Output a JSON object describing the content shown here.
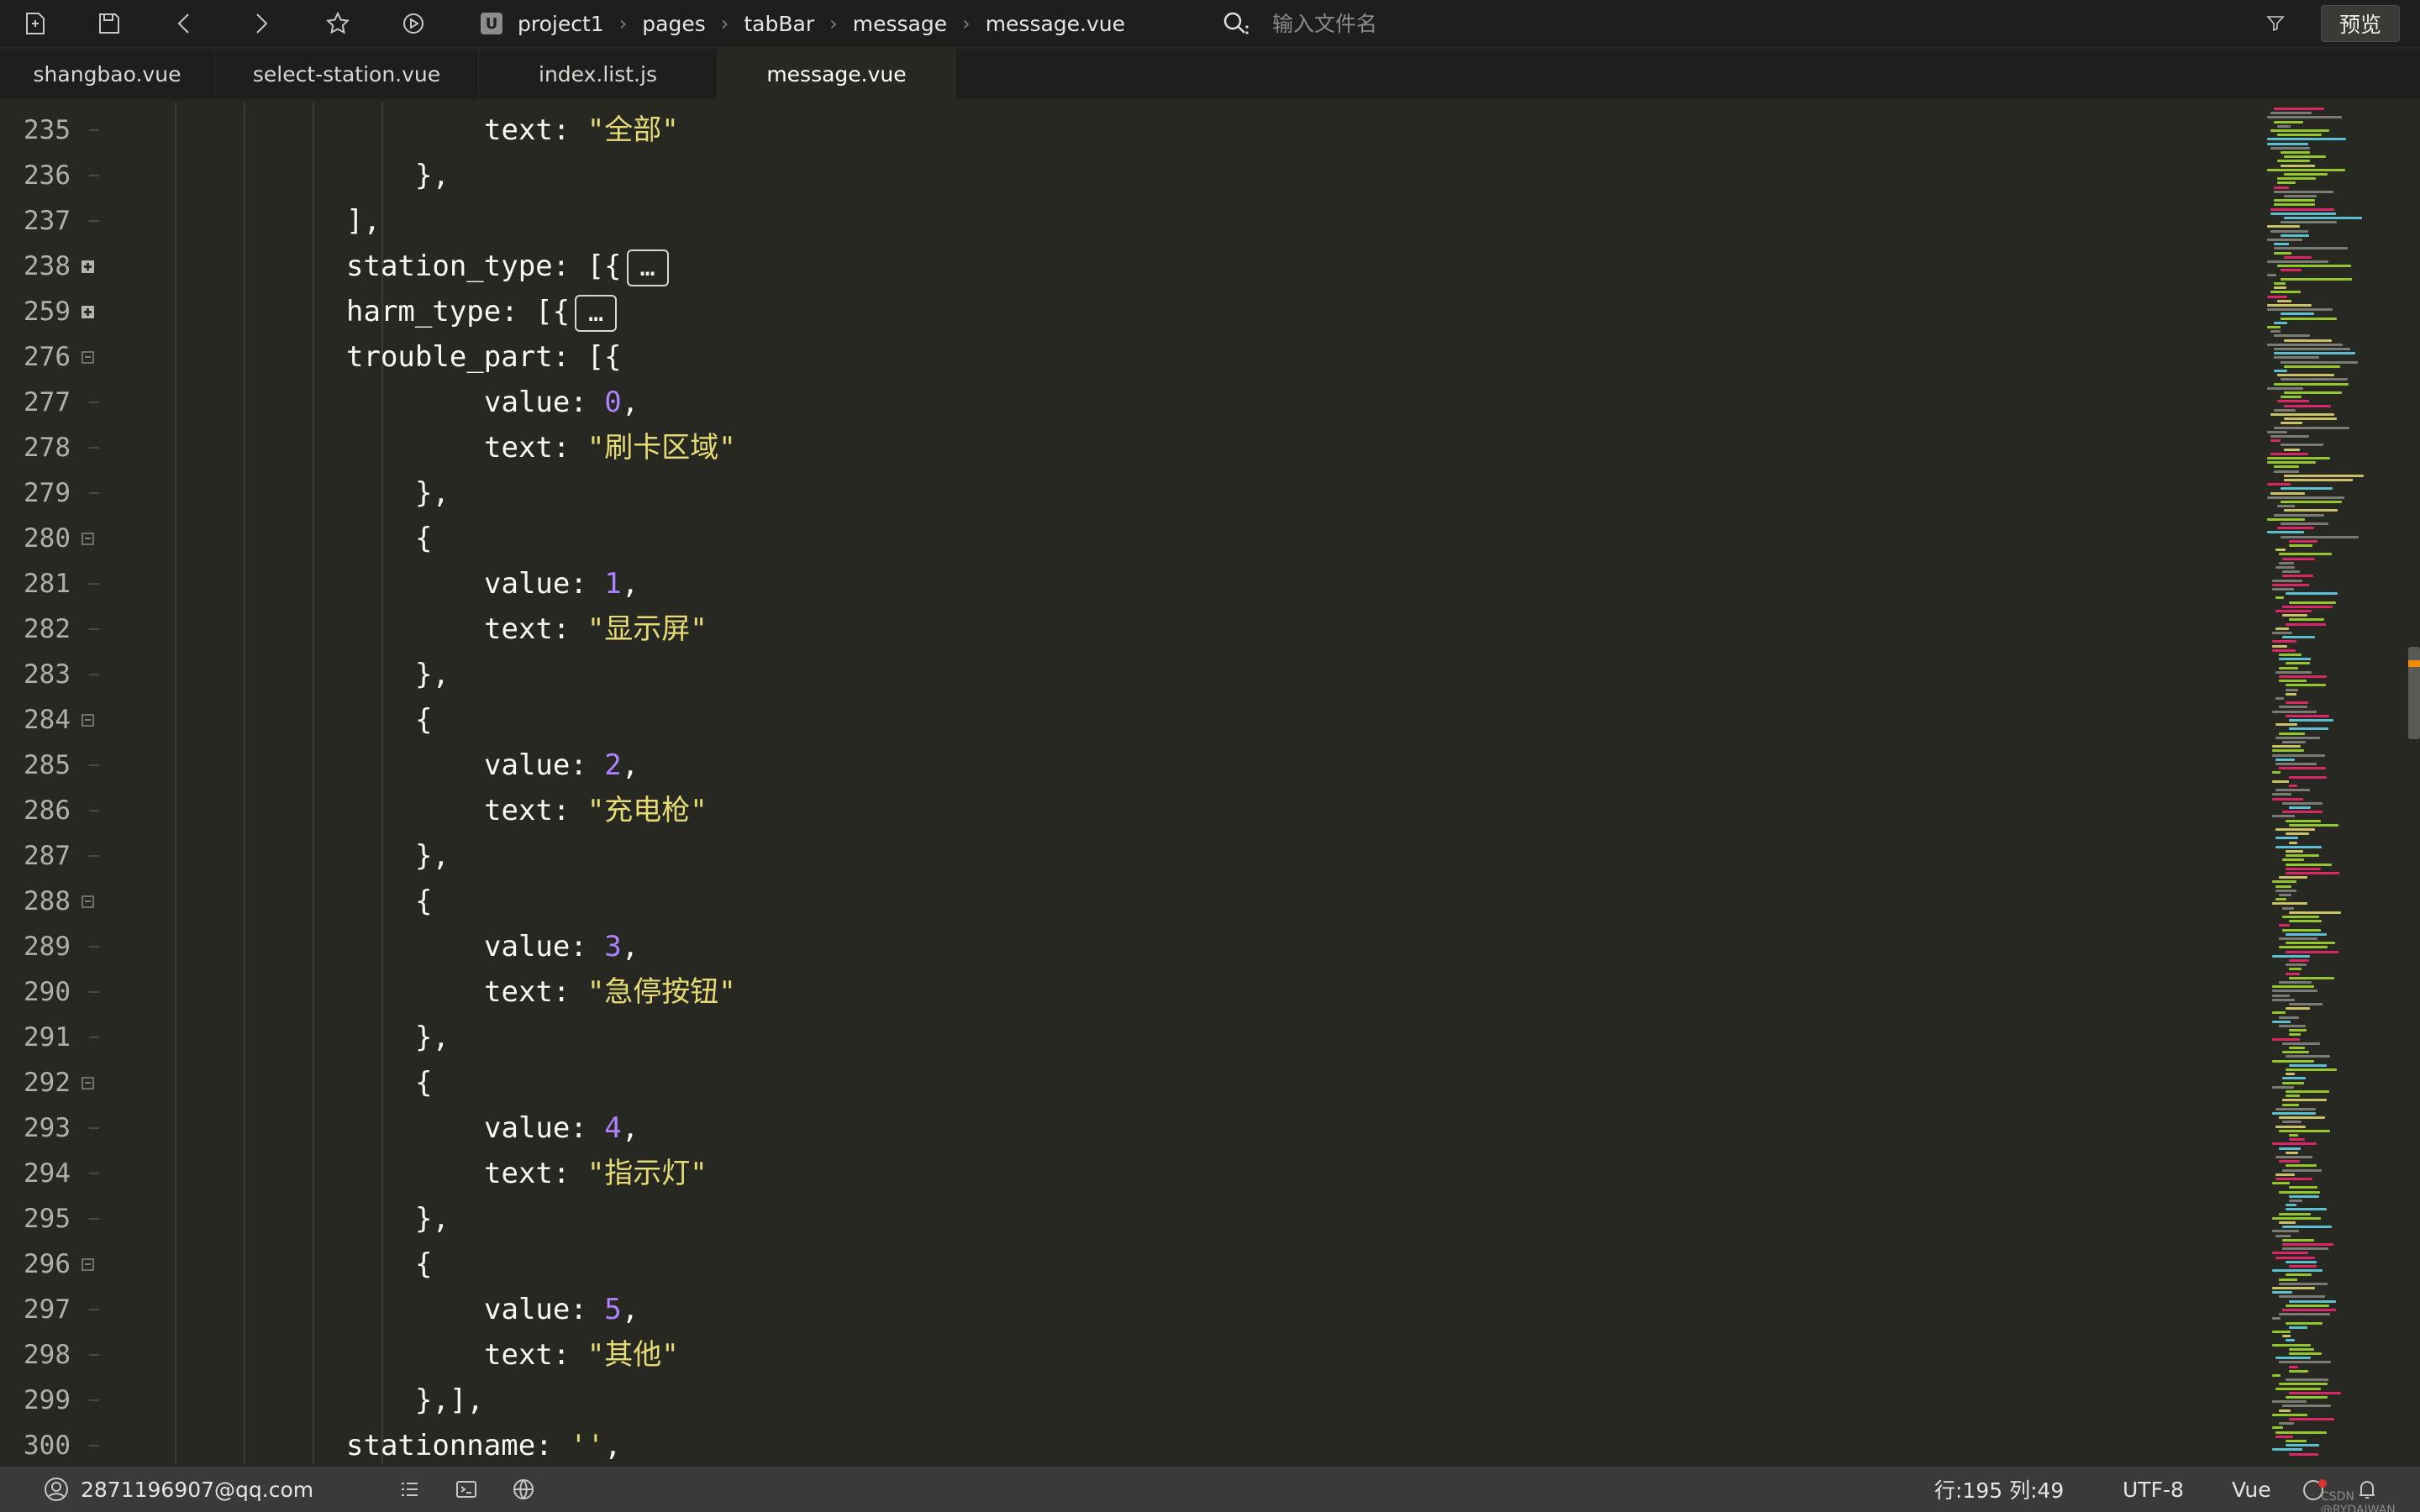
{
  "toolbar": {
    "icons": [
      "new-file-icon",
      "save-icon",
      "back-icon",
      "forward-icon",
      "star-icon",
      "run-icon"
    ],
    "breadcrumb": [
      "project1",
      "pages",
      "tabBar",
      "message",
      "message.vue"
    ],
    "search_placeholder": "输入文件名",
    "preview_label": "预览"
  },
  "tabs": [
    {
      "label": "shangbao.vue",
      "active": false
    },
    {
      "label": "select-station.vue",
      "active": false
    },
    {
      "label": "index.list.js",
      "active": false
    },
    {
      "label": "message.vue",
      "active": true
    }
  ],
  "editor": {
    "lines": [
      {
        "n": "235",
        "fold": "",
        "indent": 6,
        "tokens": [
          [
            "p",
            "text: "
          ],
          [
            "s",
            "\"全部\""
          ]
        ]
      },
      {
        "n": "236",
        "fold": "",
        "indent": 5,
        "tokens": [
          [
            "p",
            "},"
          ]
        ]
      },
      {
        "n": "237",
        "fold": "",
        "indent": 4,
        "tokens": [
          [
            "p",
            "],"
          ]
        ]
      },
      {
        "n": "238",
        "fold": "plus",
        "indent": 4,
        "tokens": [
          [
            "p",
            "station_type: [{"
          ],
          [
            "b",
            "…"
          ]
        ]
      },
      {
        "n": "259",
        "fold": "plus",
        "indent": 4,
        "tokens": [
          [
            "p",
            "harm_type: [{"
          ],
          [
            "b",
            "…"
          ]
        ]
      },
      {
        "n": "276",
        "fold": "minus",
        "indent": 4,
        "tokens": [
          [
            "p",
            "trouble_part: [{"
          ]
        ]
      },
      {
        "n": "277",
        "fold": "",
        "indent": 6,
        "tokens": [
          [
            "p",
            "value: "
          ],
          [
            "n",
            "0"
          ],
          [
            "p",
            ","
          ]
        ]
      },
      {
        "n": "278",
        "fold": "",
        "indent": 6,
        "tokens": [
          [
            "p",
            "text: "
          ],
          [
            "s",
            "\"刷卡区域\""
          ]
        ]
      },
      {
        "n": "279",
        "fold": "",
        "indent": 5,
        "tokens": [
          [
            "p",
            "},"
          ]
        ]
      },
      {
        "n": "280",
        "fold": "minus",
        "indent": 5,
        "tokens": [
          [
            "p",
            "{"
          ]
        ]
      },
      {
        "n": "281",
        "fold": "",
        "indent": 6,
        "tokens": [
          [
            "p",
            "value: "
          ],
          [
            "n",
            "1"
          ],
          [
            "p",
            ","
          ]
        ]
      },
      {
        "n": "282",
        "fold": "",
        "indent": 6,
        "tokens": [
          [
            "p",
            "text: "
          ],
          [
            "s",
            "\"显示屏\""
          ]
        ]
      },
      {
        "n": "283",
        "fold": "",
        "indent": 5,
        "tokens": [
          [
            "p",
            "},"
          ]
        ]
      },
      {
        "n": "284",
        "fold": "minus",
        "indent": 5,
        "tokens": [
          [
            "p",
            "{"
          ]
        ]
      },
      {
        "n": "285",
        "fold": "",
        "indent": 6,
        "tokens": [
          [
            "p",
            "value: "
          ],
          [
            "n",
            "2"
          ],
          [
            "p",
            ","
          ]
        ]
      },
      {
        "n": "286",
        "fold": "",
        "indent": 6,
        "tokens": [
          [
            "p",
            "text: "
          ],
          [
            "s",
            "\"充电枪\""
          ]
        ]
      },
      {
        "n": "287",
        "fold": "",
        "indent": 5,
        "tokens": [
          [
            "p",
            "},"
          ]
        ]
      },
      {
        "n": "288",
        "fold": "minus",
        "indent": 5,
        "tokens": [
          [
            "p",
            "{"
          ]
        ]
      },
      {
        "n": "289",
        "fold": "",
        "indent": 6,
        "tokens": [
          [
            "p",
            "value: "
          ],
          [
            "n",
            "3"
          ],
          [
            "p",
            ","
          ]
        ]
      },
      {
        "n": "290",
        "fold": "",
        "indent": 6,
        "tokens": [
          [
            "p",
            "text: "
          ],
          [
            "s",
            "\"急停按钮\""
          ]
        ]
      },
      {
        "n": "291",
        "fold": "",
        "indent": 5,
        "tokens": [
          [
            "p",
            "},"
          ]
        ]
      },
      {
        "n": "292",
        "fold": "minus",
        "indent": 5,
        "tokens": [
          [
            "p",
            "{"
          ]
        ]
      },
      {
        "n": "293",
        "fold": "",
        "indent": 6,
        "tokens": [
          [
            "p",
            "value: "
          ],
          [
            "n",
            "4"
          ],
          [
            "p",
            ","
          ]
        ]
      },
      {
        "n": "294",
        "fold": "",
        "indent": 6,
        "tokens": [
          [
            "p",
            "text: "
          ],
          [
            "s",
            "\"指示灯\""
          ]
        ]
      },
      {
        "n": "295",
        "fold": "",
        "indent": 5,
        "tokens": [
          [
            "p",
            "},"
          ]
        ]
      },
      {
        "n": "296",
        "fold": "minus",
        "indent": 5,
        "tokens": [
          [
            "p",
            "{"
          ]
        ]
      },
      {
        "n": "297",
        "fold": "",
        "indent": 6,
        "tokens": [
          [
            "p",
            "value: "
          ],
          [
            "n",
            "5"
          ],
          [
            "p",
            ","
          ]
        ]
      },
      {
        "n": "298",
        "fold": "",
        "indent": 6,
        "tokens": [
          [
            "p",
            "text: "
          ],
          [
            "s",
            "\"其他\""
          ]
        ]
      },
      {
        "n": "299",
        "fold": "",
        "indent": 5,
        "tokens": [
          [
            "p",
            "},],"
          ]
        ]
      },
      {
        "n": "300",
        "fold": "",
        "indent": 4,
        "tokens": [
          [
            "p",
            "stationname: "
          ],
          [
            "s",
            "''"
          ],
          [
            "p",
            ","
          ]
        ]
      }
    ]
  },
  "statusbar": {
    "user": "2871196907@qq.com",
    "icons": [
      "list-icon",
      "terminal-icon",
      "globe-icon",
      "notification-icon"
    ],
    "position": "行:195  列:49",
    "encoding": "UTF-8",
    "language": "Vue",
    "watermark": "CSDN @RYDAIWAN"
  },
  "colors": {
    "background": "#272822",
    "string": "#e6db74",
    "number": "#ae81ff",
    "text": "#f8f8f2",
    "scroll_marker": "#f08c00"
  }
}
